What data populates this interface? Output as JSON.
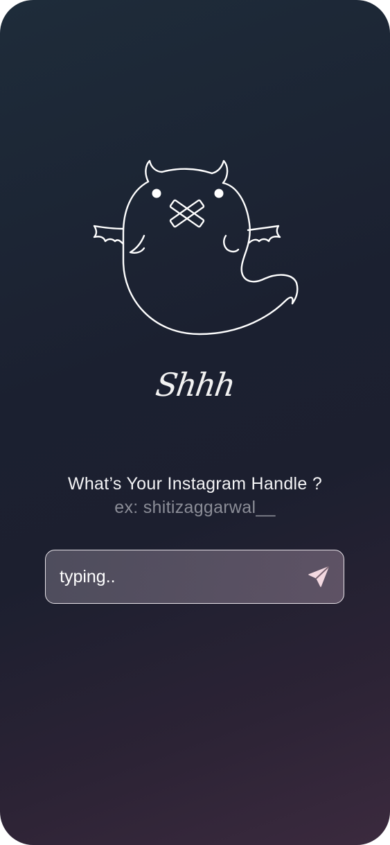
{
  "screen": {
    "brand_word": "Shhh",
    "question": "What’s Your Instagram Handle ?",
    "example": "ex: shitizaggarwal__"
  },
  "handle_input": {
    "placeholder": "typing..",
    "value": ""
  },
  "icons": {
    "mascot": "devil-ghost-icon",
    "send": "send-icon"
  },
  "colors": {
    "background_top": "#1e2c3a",
    "background_bottom": "#3b2a3e",
    "text_primary": "#f4f4f6",
    "text_muted": "#8b8d97",
    "input_border": "#e9e4ea"
  }
}
